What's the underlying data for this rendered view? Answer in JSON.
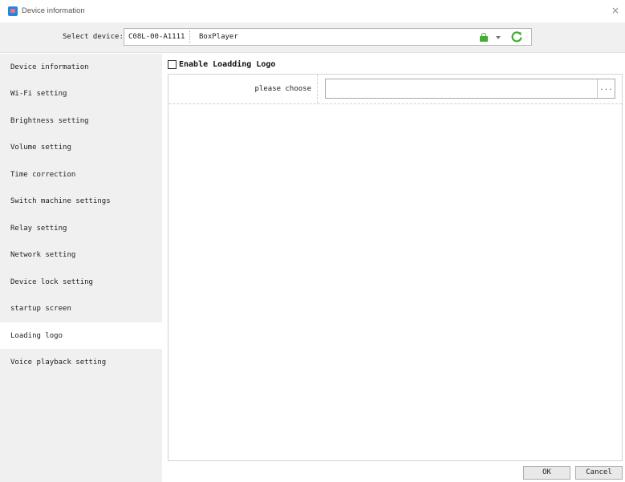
{
  "window": {
    "title": "Device information",
    "close_glyph": "×"
  },
  "device_bar": {
    "label": "Select device:",
    "device_id": "C08L-00-A1111",
    "device_name": "BoxPlayer"
  },
  "sidebar": {
    "items": [
      {
        "label": "Device information"
      },
      {
        "label": "Wi-Fi setting"
      },
      {
        "label": "Brightness setting"
      },
      {
        "label": "Volume setting"
      },
      {
        "label": "Time correction"
      },
      {
        "label": "Switch machine settings"
      },
      {
        "label": "Relay setting"
      },
      {
        "label": "Network setting"
      },
      {
        "label": "Device lock setting"
      },
      {
        "label": "startup screen"
      },
      {
        "label": "Loading logo"
      },
      {
        "label": "Voice playback setting"
      }
    ],
    "active_index": 10
  },
  "main": {
    "enable_label": "Enable Loadding Logo",
    "enable_checked": false,
    "choose_label": "please choose",
    "file_value": "",
    "browse_label": "..."
  },
  "buttons": {
    "ok": "OK",
    "cancel": "Cancel"
  },
  "colors": {
    "accent_green": "#3fae32",
    "sidebar_bg": "#f0f0f0",
    "active_item_bg": "#ffffff"
  }
}
